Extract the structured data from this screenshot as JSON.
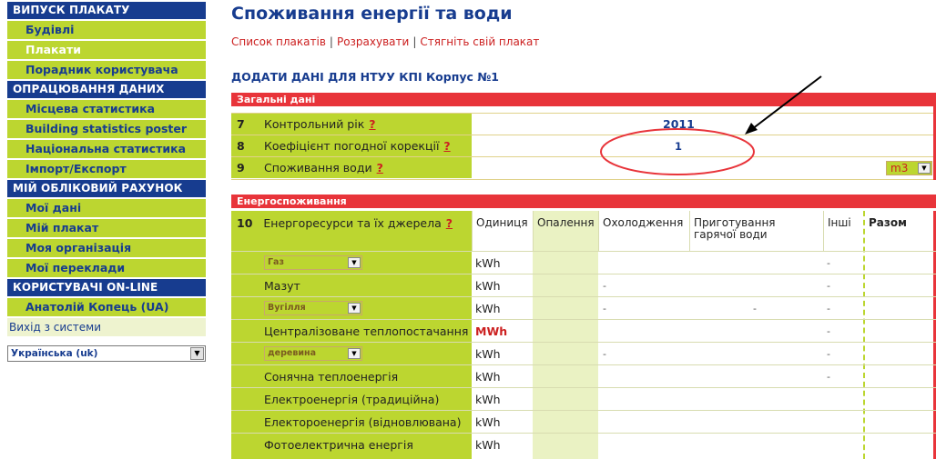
{
  "sidebar": {
    "sections": [
      {
        "header": "ВИПУСК ПЛАКАТУ",
        "items": [
          "Будівлі",
          "Плакати",
          "Порадник користувача"
        ]
      },
      {
        "header": "ОПРАЦЮВАННЯ ДАНИХ",
        "items": [
          "Місцева статистика",
          "Building statistics poster",
          "Національна статистика",
          "Імпорт/Експорт"
        ]
      },
      {
        "header": "МІЙ ОБЛІКОВИЙ РАХУНОК",
        "items": [
          "Мої дані",
          "Мій плакат",
          "Моя організація",
          "Мої переклади"
        ]
      },
      {
        "header": "КОРИСТУВАЧІ ON-LINE",
        "items": [
          "Анатолій Копець (UA)"
        ]
      }
    ],
    "exit": "Вихід з системи",
    "language": "Українська (uk)"
  },
  "header": {
    "title": "Споживання енергії та води",
    "links": [
      "Список плакатів",
      "Розрахувати",
      "Стягніть свій плакат"
    ],
    "subtitle": "ДОДАТИ ДАНІ ДЛЯ НТУУ КПІ Корпус №1"
  },
  "general": {
    "section_title": "Загальні дані",
    "rows": [
      {
        "num": "7",
        "label": "Контрольний рік",
        "help": "?",
        "value": "2011"
      },
      {
        "num": "8",
        "label": "Коефіцієнт погодної корекції",
        "help": "?",
        "value": "1"
      },
      {
        "num": "9",
        "label": "Споживання води",
        "help": "?",
        "unit": "m3"
      }
    ]
  },
  "energy": {
    "section_title": "Енергоспоживання",
    "header": {
      "num": "10",
      "label": "Енергоресурси та їх джерела",
      "help": "?",
      "cols": [
        "Одиниця",
        "Опалення",
        "Охолодження",
        "Приготування гарячої води",
        "Інші",
        "Разом"
      ]
    },
    "rows": [
      {
        "label": "Газ",
        "select": true,
        "unit": "kWh"
      },
      {
        "label": "Мазут",
        "unit": "kWh"
      },
      {
        "label": "Вугілля",
        "select": true,
        "unit": "kWh"
      },
      {
        "label": "Централізоване теплопостачання",
        "unit": "MWh"
      },
      {
        "label": "деревина",
        "select": true,
        "unit": "kWh"
      },
      {
        "label": "Сонячна теплоенергія",
        "unit": "kWh"
      },
      {
        "label": "Електроенергія (традиційна)",
        "unit": "kWh"
      },
      {
        "label": "Електороенергія (відновлювана)",
        "unit": "kWh"
      },
      {
        "label": "Фотоелектрична енергія",
        "unit": "kWh"
      }
    ],
    "dash": "-"
  },
  "colors": {
    "navy": "#173c8f",
    "lime": "#bcd630",
    "red": "#e8343a",
    "annotation": "#e8343a"
  }
}
